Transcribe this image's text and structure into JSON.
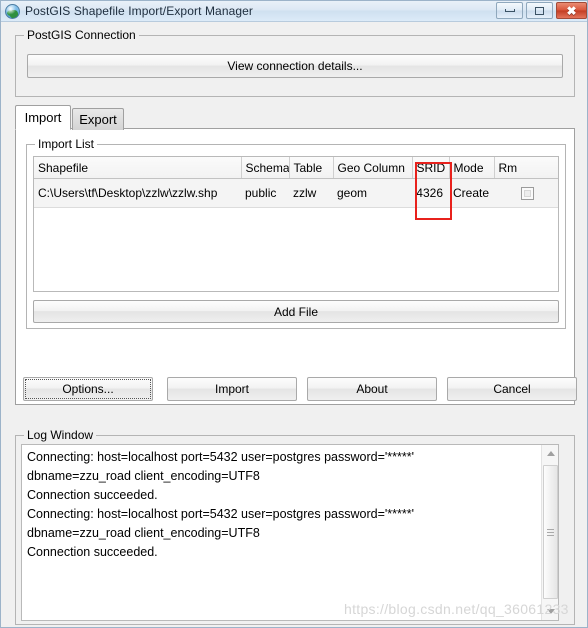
{
  "window": {
    "title": "PostGIS Shapefile Import/Export Manager",
    "icon": "globe-icon",
    "controls": {
      "minimize": "minimize",
      "maximize": "maximize",
      "close": "close"
    }
  },
  "connection_group": {
    "legend": "PostGIS Connection",
    "view_details_button": "View connection details..."
  },
  "tabs": [
    {
      "label": "Import",
      "active": true
    },
    {
      "label": "Export",
      "active": false
    }
  ],
  "import_list": {
    "legend": "Import List",
    "columns": [
      "Shapefile",
      "Schema",
      "Table",
      "Geo Column",
      "SRID",
      "Mode",
      "Rm"
    ],
    "rows": [
      {
        "shapefile": "C:\\Users\\tf\\Desktop\\zzlw\\zzlw.shp",
        "schema": "public",
        "table": "zzlw",
        "geo_column": "geom",
        "srid": "4326",
        "mode": "Create",
        "rm": false
      }
    ],
    "add_file_button": "Add File",
    "annotation": {
      "type": "red-rectangle",
      "target_column": "SRID",
      "color": "#e8211c"
    }
  },
  "action_buttons": [
    {
      "label": "Options...",
      "focused": true
    },
    {
      "label": "Import",
      "focused": false
    },
    {
      "label": "About",
      "focused": false
    },
    {
      "label": "Cancel",
      "focused": false
    }
  ],
  "log_window": {
    "legend": "Log Window",
    "text": "Connecting: host=localhost port=5432 user=postgres password='*****'\ndbname=zzu_road client_encoding=UTF8\nConnection succeeded.\nConnecting: host=localhost port=5432 user=postgres password='*****'\ndbname=zzu_road client_encoding=UTF8\nConnection succeeded."
  },
  "watermark": "https://blog.csdn.net/qq_36061233"
}
